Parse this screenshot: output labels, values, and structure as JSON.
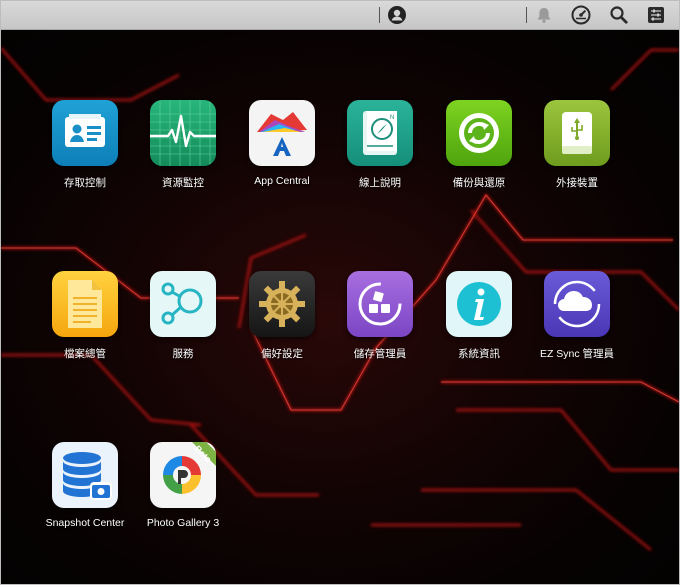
{
  "topbar": {
    "icons": [
      "user-icon",
      "bell-icon",
      "gauge-icon",
      "search-icon",
      "settings-icon"
    ]
  },
  "apps": [
    {
      "label": "存取控制",
      "icon": "access-control-icon"
    },
    {
      "label": "資源監控",
      "icon": "resource-monitor-icon"
    },
    {
      "label": "App Central",
      "icon": "app-central-icon"
    },
    {
      "label": "線上說明",
      "icon": "online-help-icon"
    },
    {
      "label": "備份與還原",
      "icon": "backup-restore-icon"
    },
    {
      "label": "外接裝置",
      "icon": "external-device-icon"
    },
    {
      "label": "檔案總管",
      "icon": "file-explorer-icon"
    },
    {
      "label": "服務",
      "icon": "services-icon"
    },
    {
      "label": "偏好設定",
      "icon": "preferences-icon"
    },
    {
      "label": "儲存管理員",
      "icon": "storage-manager-icon"
    },
    {
      "label": "系統資訊",
      "icon": "system-info-icon"
    },
    {
      "label": "EZ Sync 管理員",
      "icon": "ez-sync-icon"
    },
    {
      "label": "Snapshot Center",
      "icon": "snapshot-center-icon"
    },
    {
      "label": "Photo Gallery 3",
      "icon": "photo-gallery-icon",
      "badge": "Beta"
    }
  ]
}
